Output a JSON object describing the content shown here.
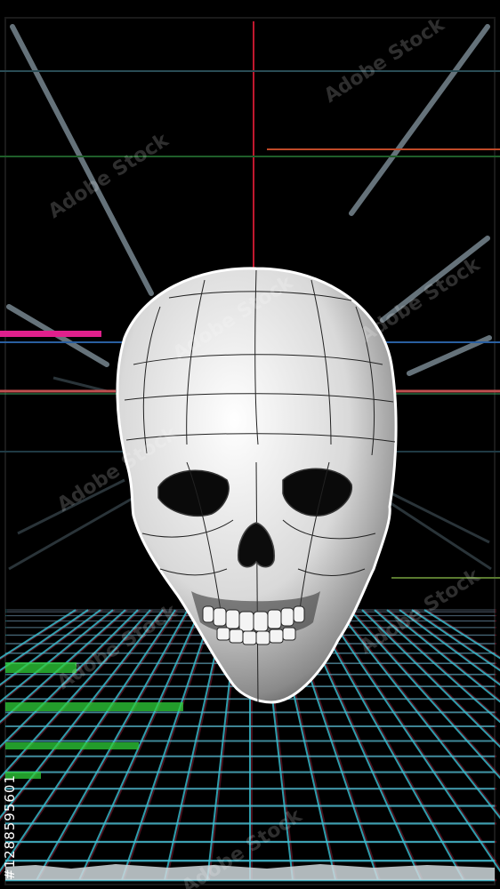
{
  "image": {
    "watermark_text": "Adobe Stock",
    "stock_id_text": "#1288595601",
    "colors": {
      "background": "#000000",
      "grid_cyan": "#39c4d6",
      "glitch_magenta": "#e0208c",
      "glitch_green": "#2fd13a",
      "skull_light": "#f2f2f2",
      "skull_shadow": "#2a2a2a"
    }
  }
}
